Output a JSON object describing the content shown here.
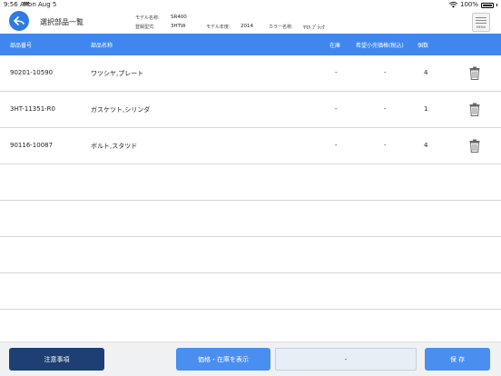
{
  "status": {
    "time": "9:56 AM",
    "date": "Mon Aug 5",
    "battery": "100%"
  },
  "header": {
    "title": "選択部品一覧",
    "model_name_label": "モデル名称:",
    "model_name": "SR400",
    "type_label": "登録型式:",
    "type": "3HTW",
    "year_label": "モデル年度:",
    "year": "2014",
    "color_label": "カラー名称:",
    "color": "ﾔﾏﾊ ﾌﾞﾗｯｸ",
    "menu_label": "MENU"
  },
  "table": {
    "columns": [
      "部品番号",
      "部品名称",
      "在庫",
      "希望小売価格(税込)",
      "個数"
    ],
    "rows": [
      {
        "part_no": "90201-10590",
        "name": "ワツシヤ,プレート",
        "stock": "-",
        "price": "-",
        "qty": "4"
      },
      {
        "part_no": "3HT-11351-R0",
        "name": "ガスケツト,シリンダ",
        "stock": "-",
        "price": "-",
        "qty": "1"
      },
      {
        "part_no": "90116-10087",
        "name": "ボルト,スタツド",
        "stock": "-",
        "price": "-",
        "qty": "4"
      }
    ]
  },
  "footer": {
    "notice_label": "注意事項",
    "price_label": "価格・在庫を表示",
    "field_value": "-",
    "save_label": "保 存"
  },
  "colors": {
    "accent": "#3f87ef",
    "dark_button": "#1d3f74"
  }
}
